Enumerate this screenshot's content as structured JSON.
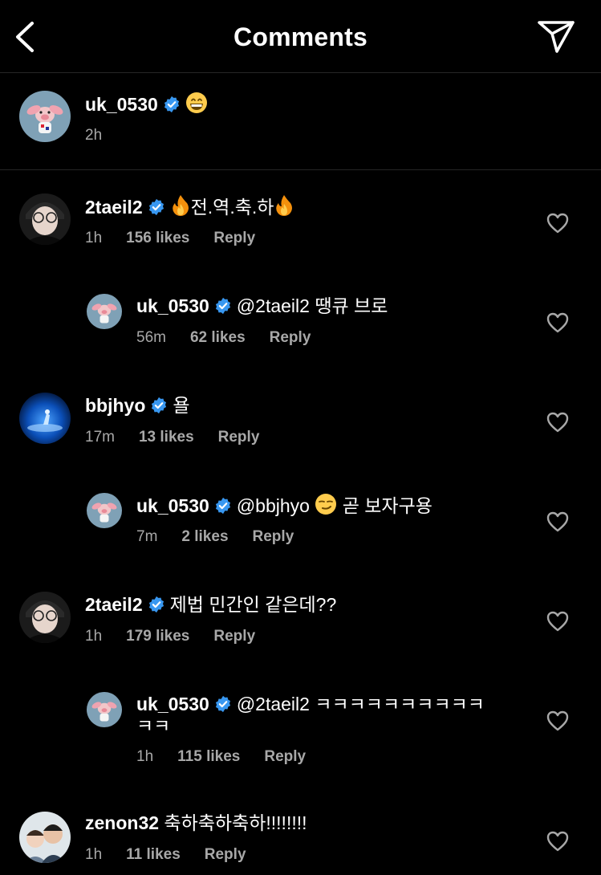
{
  "header": {
    "title": "Comments"
  },
  "caption": {
    "username": "uk_0530",
    "text": "",
    "emoji": "grinning-face",
    "time": "2h"
  },
  "comments": [
    {
      "username": "2taeil2",
      "text": "전.역.축.하",
      "time": "1h",
      "likes": "156 likes",
      "reply": "Reply",
      "emoji": "fire"
    },
    {
      "username": "uk_0530",
      "text": "@2taeil2 땡큐 브로",
      "time": "56m",
      "likes": "62 likes",
      "reply": "Reply"
    },
    {
      "username": "bbjhyo",
      "text": "욜",
      "time": "17m",
      "likes": "13 likes",
      "reply": "Reply"
    },
    {
      "username": "uk_0530",
      "text_before": "@bbjhyo",
      "text_after": "곧 보자구용",
      "time": "7m",
      "likes": "2 likes",
      "reply": "Reply",
      "emoji": "smirking-face"
    },
    {
      "username": "2taeil2",
      "text": "제법 민간인 같은데??",
      "time": "1h",
      "likes": "179 likes",
      "reply": "Reply"
    },
    {
      "username": "uk_0530",
      "text": "@2taeil2 ㅋㅋㅋㅋㅋㅋㅋㅋㅋㅋ",
      "text_line2": "ㅋㅋ",
      "time": "1h",
      "likes": "115 likes",
      "reply": "Reply"
    },
    {
      "username": "zenon32",
      "text": "축하축하축하!!!!!!!!",
      "time": "1h",
      "likes": "11 likes",
      "reply": "Reply"
    }
  ],
  "colors": {
    "background": "#000000",
    "verified": "#3897f0",
    "meta": "#a8a8a8",
    "divider": "#262626"
  }
}
